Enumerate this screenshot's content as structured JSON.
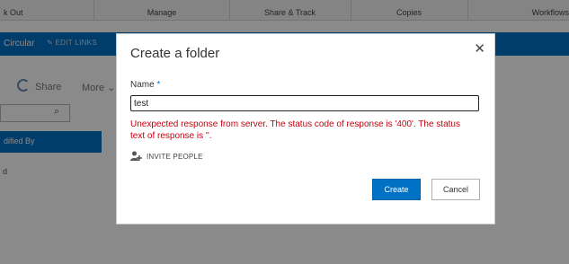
{
  "ribbon": {
    "groups": [
      "k Out",
      "Manage",
      "Share & Track",
      "Copies",
      "Workflows"
    ]
  },
  "site": {
    "name": "Circular",
    "edit_links": "EDIT LINKS"
  },
  "commands": {
    "share": "Share",
    "more": "More"
  },
  "list": {
    "column_header": "dified By",
    "row_fragment": "d"
  },
  "dialog": {
    "title": "Create a folder",
    "close_glyph": "✕",
    "name_label": "Name",
    "required_mark": "*",
    "name_value": "test",
    "error_text": "Unexpected response from server. The status code of response is '400'. The status text of response is ''.",
    "invite_label": "INVITE PEOPLE",
    "create_label": "Create",
    "cancel_label": "Cancel"
  },
  "icons": {
    "close": "close-icon",
    "invite": "add-person-icon",
    "search": "search-icon",
    "sync": "sync-icon",
    "chevron": "chevron-down-icon"
  },
  "colors": {
    "accent": "#0072c6",
    "error": "#c8000d",
    "overlay": "rgba(0,0,0,0.46)"
  }
}
